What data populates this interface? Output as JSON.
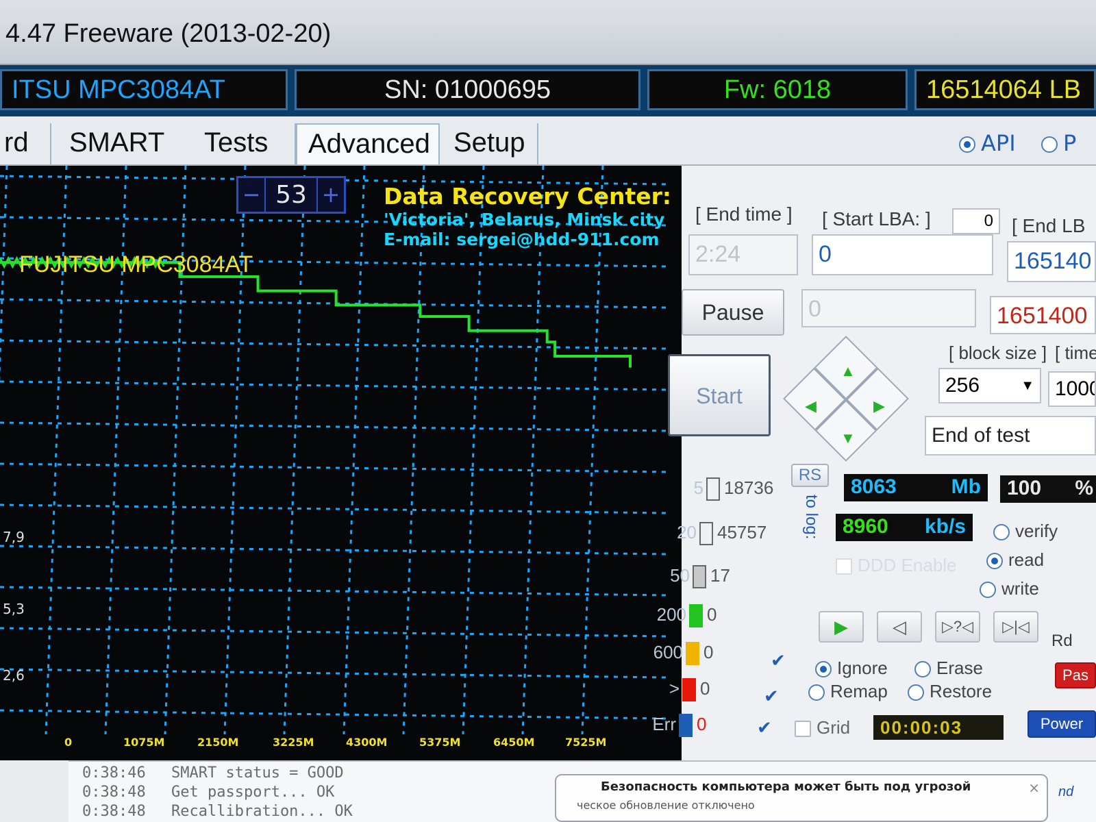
{
  "window": {
    "title": "4.47  Freeware (2013-02-20)"
  },
  "info": {
    "model": "ITSU MPC3084AT",
    "serial": "SN: 01000695",
    "firmware": "Fw: 6018",
    "lba": "16514064 LB"
  },
  "tabs": [
    {
      "label": "rd"
    },
    {
      "label": "SMART"
    },
    {
      "label": "Tests"
    },
    {
      "label": "Advanced"
    },
    {
      "label": "Setup"
    }
  ],
  "plot": {
    "spin_value": "53",
    "spin_minus": "−",
    "spin_plus": "+",
    "drive_label": "FUJITSU MPC3084AT",
    "drc_heading": "Data Recovery Center:",
    "drc_line1": "'Victoria', Belarus, Minsk city",
    "drc_line2": "E-mail: sergei@hdd-911.com",
    "y_ticks": [
      "7,9",
      "5,3",
      "2,6"
    ],
    "x_ticks": [
      "0",
      "1075M",
      "2150M",
      "3225M",
      "4300M",
      "5375M",
      "6450M",
      "7525M"
    ],
    "grid_color": "#19a8ff",
    "line_color": "#27e12a"
  },
  "chart_data": {
    "type": "line",
    "title": "",
    "xlabel": "",
    "ylabel": "",
    "x_ticks": [
      "0",
      "1075M",
      "2150M",
      "3225M",
      "4300M",
      "5375M",
      "6450M",
      "7525M"
    ],
    "y_ticks": [
      "2,6",
      "5,3",
      "7,9"
    ],
    "series": [
      {
        "x": [
          0,
          1075,
          2150,
          2300,
          3225,
          3300,
          4000,
          4300,
          5000,
          5375,
          6000,
          6450,
          7000,
          7100,
          7525,
          8063
        ],
        "y": [
          16.6,
          16.6,
          16.6,
          16.1,
          16.1,
          15.6,
          15.6,
          15.1,
          15.1,
          14.7,
          14.2,
          14.2,
          13.8,
          13.3,
          13.3,
          12.9
        ]
      }
    ]
  },
  "controls": {
    "api_label": "API",
    "p_label": "P",
    "end_time_label": "[ End time ]",
    "end_time_value": "2:24",
    "start_lba_label": "[ Start LBA: ]",
    "start_lba_small": "0",
    "start_lba_value": "0",
    "end_lba_label": "[ End LB",
    "end_lba_value": "165140",
    "pause_label": "Pause",
    "second_field": "0",
    "red_value": "1651400",
    "start_label": "Start",
    "block_size_label": "[ block size ]",
    "block_size_value": "256",
    "timeout_label": "[ time",
    "timeout_value": "1000",
    "status_text": "End of test",
    "rs_label": "RS",
    "to_log_label": "to log:",
    "mb_value": "8063",
    "mb_unit": "Mb",
    "percent_value": "100",
    "percent_unit": "%",
    "speed_value": "8960",
    "speed_unit": "kb/s",
    "ddd_label": "DDD Enable",
    "verify_label": "verify",
    "read_label": "read",
    "write_label": "write",
    "ignore_label": "Ignore",
    "erase_label": "Erase",
    "remap_label": "Remap",
    "restore_label": "Restore",
    "grid_label": "Grid",
    "timer": "00:00:03",
    "rd_label": "Rd",
    "pas_label": "Pas",
    "power_label": "Power"
  },
  "counters": [
    {
      "threshold": "5",
      "count": "18736",
      "color": "#ffffff"
    },
    {
      "threshold": "20",
      "count": "45757",
      "color": "#ffffff"
    },
    {
      "threshold": "50",
      "count": "17",
      "color": "#c8c8c8"
    },
    {
      "threshold": "200",
      "count": "0",
      "color": "#22c51f"
    },
    {
      "threshold": "600",
      "count": "0",
      "color": "#f0b400"
    },
    {
      "threshold": ">",
      "count": "0",
      "color": "#e8180c"
    },
    {
      "threshold": "Err",
      "count": "0",
      "color": "#1d5fb7"
    }
  ],
  "log": [
    {
      "time": "0:38:46",
      "text": "SMART status = GOOD"
    },
    {
      "time": "0:38:48",
      "text": "Get passport... OK"
    },
    {
      "time": "0:38:48",
      "text": "Recallibration... OK"
    }
  ],
  "notification": {
    "title": "Безопасность компьютера может быть под угрозой",
    "text": "ческое обновление отключено",
    "close": "×",
    "side_text": "nd"
  }
}
